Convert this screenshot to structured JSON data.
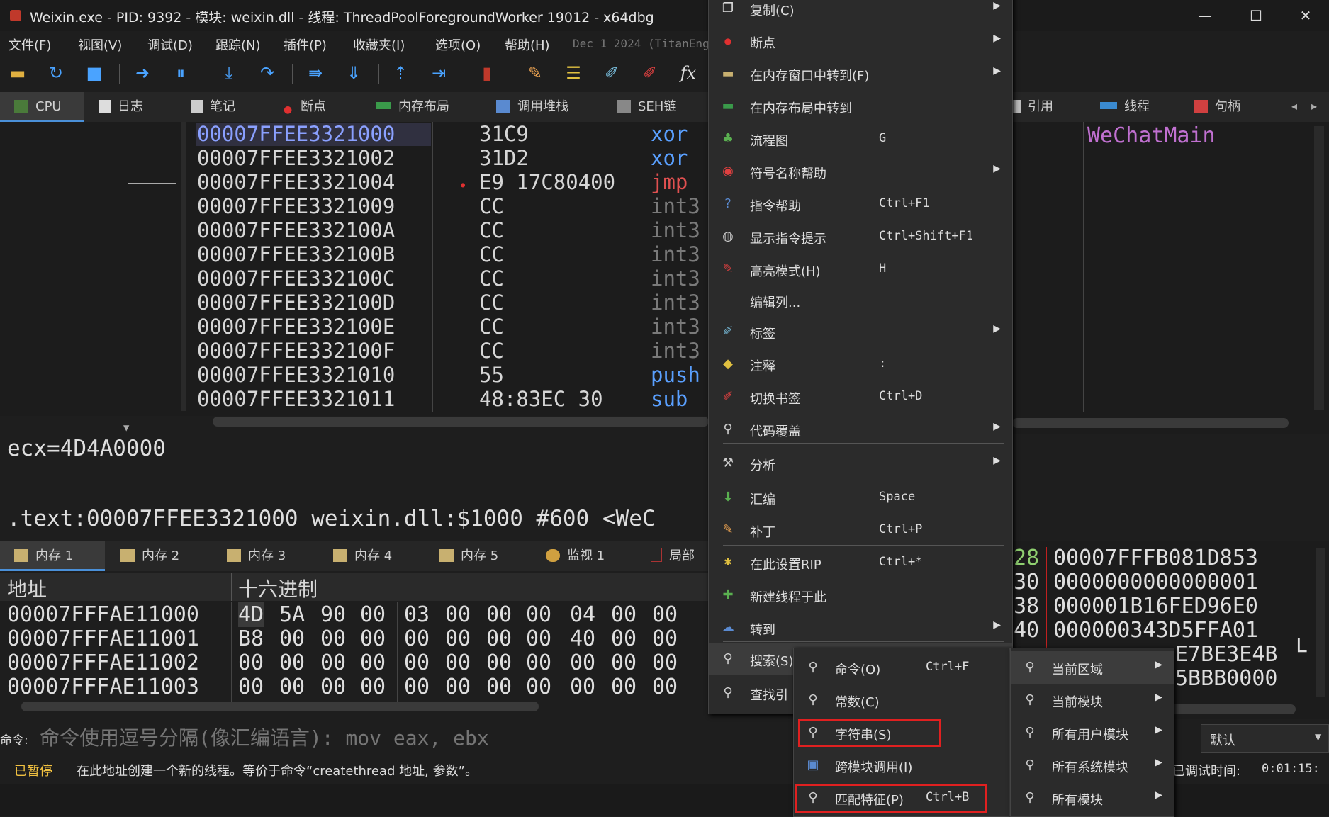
{
  "window": {
    "title": "Weixin.exe - PID: 9392 - 模块: weixin.dll - 线程: ThreadPoolForegroundWorker 19012 - x64dbg",
    "controls": {
      "minimize": "—",
      "maximize": "☐",
      "close": "✕"
    }
  },
  "menubar": {
    "items": [
      "文件(F)",
      "视图(V)",
      "调试(D)",
      "跟踪(N)",
      "插件(P)",
      "收藏夹(I)",
      "选项(O)",
      "帮助(H)"
    ],
    "build": "Dec 1 2024 (TitanEng"
  },
  "tabs_top": {
    "left": [
      {
        "label": "CPU",
        "icon": "cpu-icon"
      },
      {
        "label": "日志",
        "icon": "log-icon"
      },
      {
        "label": "笔记",
        "icon": "notes-icon"
      },
      {
        "label": "断点",
        "icon": "breakpoint-icon"
      },
      {
        "label": "内存布局",
        "icon": "memory-map-icon"
      },
      {
        "label": "调用堆栈",
        "icon": "call-stack-icon"
      },
      {
        "label": "SEH链",
        "icon": "seh-icon"
      }
    ],
    "right": [
      {
        "label": "引用",
        "icon": "references-icon"
      },
      {
        "label": "线程",
        "icon": "threads-icon"
      },
      {
        "label": "句柄",
        "icon": "handles-icon"
      }
    ]
  },
  "disasm": {
    "rows": [
      {
        "addr": "00007FFEE3321000",
        "bytes": "31C9",
        "ins": "xor",
        "style": "normal"
      },
      {
        "addr": "00007FFEE3321002",
        "bytes": "31D2",
        "ins": "xor",
        "style": "normal"
      },
      {
        "addr": "00007FFEE3321004",
        "bytes": "E9 17C80400",
        "ins": "jmp",
        "style": "red"
      },
      {
        "addr": "00007FFEE3321009",
        "bytes": "CC",
        "ins": "int3",
        "style": "gray"
      },
      {
        "addr": "00007FFEE332100A",
        "bytes": "CC",
        "ins": "int3",
        "style": "gray"
      },
      {
        "addr": "00007FFEE332100B",
        "bytes": "CC",
        "ins": "int3",
        "style": "gray"
      },
      {
        "addr": "00007FFEE332100C",
        "bytes": "CC",
        "ins": "int3",
        "style": "gray"
      },
      {
        "addr": "00007FFEE332100D",
        "bytes": "CC",
        "ins": "int3",
        "style": "gray"
      },
      {
        "addr": "00007FFEE332100E",
        "bytes": "CC",
        "ins": "int3",
        "style": "gray"
      },
      {
        "addr": "00007FFEE332100F",
        "bytes": "CC",
        "ins": "int3",
        "style": "gray"
      },
      {
        "addr": "00007FFEE3321010",
        "bytes": "55",
        "ins": "push",
        "style": "normal"
      },
      {
        "addr": "00007FFEE3321011",
        "bytes": "48:83EC 30",
        "ins": "sub",
        "style": "normal"
      }
    ],
    "comment_header": "WeChatMain"
  },
  "info": {
    "reg": "ecx=4D4A0000",
    "location": ".text:00007FFEE3321000 weixin.dll:$1000 #600 <WeC"
  },
  "tabs_mem": [
    {
      "label": "内存 1",
      "icon": "dump-icon"
    },
    {
      "label": "内存 2",
      "icon": "dump-icon"
    },
    {
      "label": "内存 3",
      "icon": "dump-icon"
    },
    {
      "label": "内存 4",
      "icon": "dump-icon"
    },
    {
      "label": "内存 5",
      "icon": "dump-icon"
    },
    {
      "label": "监视 1",
      "icon": "watch-icon"
    },
    {
      "label": "局部",
      "icon": "locals-icon"
    }
  ],
  "memory": {
    "headers": {
      "address": "地址",
      "hex": "十六进制"
    },
    "rows": [
      {
        "addr": "00007FFFAE11000",
        "hex": [
          "4D",
          "5A",
          "90",
          "00",
          "03",
          "00",
          "00",
          "00",
          "04",
          "00",
          "00",
          "00"
        ]
      },
      {
        "addr": "00007FFFAE11001",
        "hex": [
          "B8",
          "00",
          "00",
          "00",
          "00",
          "00",
          "00",
          "00",
          "40",
          "00",
          "00",
          "00"
        ]
      },
      {
        "addr": "00007FFFAE11002",
        "hex": [
          "00",
          "00",
          "00",
          "00",
          "00",
          "00",
          "00",
          "00",
          "00",
          "00",
          "00",
          "00"
        ]
      },
      {
        "addr": "00007FFFAE11003",
        "hex": [
          "00",
          "00",
          "00",
          "00",
          "00",
          "00",
          "00",
          "00",
          "00",
          "00",
          "00",
          "00"
        ]
      }
    ]
  },
  "stack": {
    "rows": [
      {
        "off": "28",
        "val": "00007FFFB081D853"
      },
      {
        "off": "30",
        "val": "0000000000000001"
      },
      {
        "off": "38",
        "val": "000001B16FED96E0"
      },
      {
        "off": "40",
        "val": "000000343D5FFA01"
      },
      {
        "off": "",
        "val": "E7BE3E4B"
      },
      {
        "off": "",
        "val": "5BBB0000"
      }
    ],
    "side_marks": [
      "L"
    ]
  },
  "command": {
    "label": "命令:",
    "placeholder": "命令使用逗号分隔(像汇编语言): mov eax, ebx",
    "dropdown": "默认"
  },
  "status": {
    "state": "已暂停",
    "message": "在此地址创建一个新的线程。等价于命令“createthread 地址, 参数”。",
    "debug_time_label": "已调试时间:",
    "debug_time": "0:01:15:"
  },
  "context_menu": {
    "items": [
      {
        "label": "复制(C)",
        "shortcut": "",
        "submenu": true,
        "icon": "copy-icon"
      },
      {
        "label": "断点",
        "shortcut": "",
        "submenu": true,
        "icon": "breakpoint-icon"
      },
      {
        "label": "在内存窗口中转到(F)",
        "shortcut": "",
        "submenu": true,
        "icon": "dump-icon"
      },
      {
        "label": "在内存布局中转到",
        "shortcut": "",
        "submenu": false,
        "icon": "memory-map-icon"
      },
      {
        "label": "流程图",
        "shortcut": "G",
        "submenu": false,
        "icon": "graph-icon"
      },
      {
        "label": "符号名称帮助",
        "shortcut": "",
        "submenu": true,
        "icon": "help-icon"
      },
      {
        "label": "指令帮助",
        "shortcut": "Ctrl+F1",
        "submenu": false,
        "icon": "instruction-help-icon"
      },
      {
        "label": "显示指令提示",
        "shortcut": "Ctrl+Shift+F1",
        "submenu": false,
        "icon": "hint-icon"
      },
      {
        "label": "高亮模式(H)",
        "shortcut": "H",
        "submenu": false,
        "icon": "highlight-icon"
      },
      {
        "label": "编辑列...",
        "shortcut": "",
        "submenu": false,
        "icon": ""
      },
      {
        "label": "标签",
        "shortcut": "",
        "submenu": true,
        "icon": "label-icon"
      },
      {
        "label": "注释",
        "shortcut": ":",
        "submenu": false,
        "icon": "comment-icon"
      },
      {
        "label": "切换书签",
        "shortcut": "Ctrl+D",
        "submenu": false,
        "icon": "bookmark-icon"
      },
      {
        "label": "代码覆盖",
        "shortcut": "",
        "submenu": true,
        "icon": "coverage-icon"
      },
      {
        "label": "分析",
        "shortcut": "",
        "submenu": true,
        "icon": "analysis-icon"
      },
      {
        "label": "汇编",
        "shortcut": "Space",
        "submenu": false,
        "icon": "assemble-icon"
      },
      {
        "label": "补丁",
        "shortcut": "Ctrl+P",
        "submenu": false,
        "icon": "patch-icon"
      },
      {
        "label": "在此设置RIP",
        "shortcut": "Ctrl+*",
        "submenu": false,
        "icon": "set-rip-icon"
      },
      {
        "label": "新建线程于此",
        "shortcut": "",
        "submenu": false,
        "icon": "new-thread-icon"
      },
      {
        "label": "转到",
        "shortcut": "",
        "submenu": true,
        "icon": "goto-icon"
      },
      {
        "label": "搜索(S)",
        "shortcut": "",
        "submenu": true,
        "icon": "search-icon"
      },
      {
        "label": "查找引",
        "shortcut": "",
        "submenu": false,
        "icon": "find-refs-icon"
      }
    ]
  },
  "search_submenu": {
    "items": [
      {
        "label": "命令(O)",
        "shortcut": "Ctrl+F",
        "icon": "search-icon"
      },
      {
        "label": "常数(C)",
        "shortcut": "",
        "icon": "search-icon"
      },
      {
        "label": "字符串(S)",
        "shortcut": "",
        "icon": "search-icon"
      },
      {
        "label": "跨模块调用(I)",
        "shortcut": "",
        "icon": "intermodular-icon"
      },
      {
        "label": "匹配特征(P)",
        "shortcut": "Ctrl+B",
        "icon": "search-icon"
      }
    ]
  },
  "scope_submenu": {
    "items": [
      {
        "label": "当前区域"
      },
      {
        "label": "当前模块"
      },
      {
        "label": "所有用户模块"
      },
      {
        "label": "所有系统模块"
      },
      {
        "label": "所有模块"
      }
    ]
  },
  "colors": {
    "accent": "#4a90d9",
    "highlight_box": "#e02020",
    "instruction": "#5aa0ff",
    "jump": "#e05050"
  }
}
